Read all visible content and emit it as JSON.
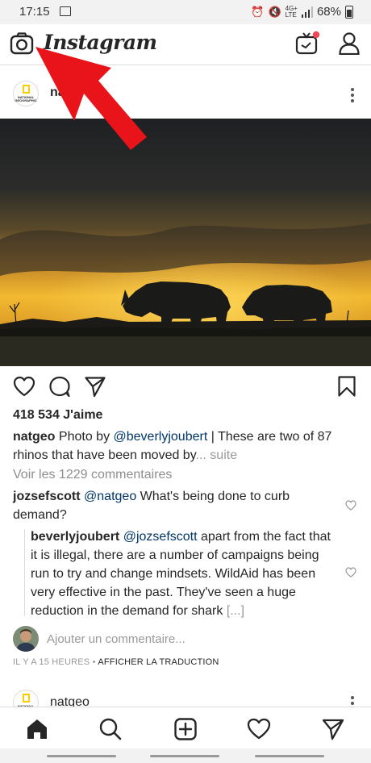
{
  "status_bar": {
    "time": "17:15",
    "battery": "68%",
    "network": "4G+",
    "network_sub": "LTE"
  },
  "app": {
    "title": "Instagram"
  },
  "post": {
    "username": "natgeo",
    "avatar_text": "NATIONAL GEOGRAPHIC",
    "likes": "418 534 J'aime",
    "caption_user": "natgeo",
    "caption_text_1": "Photo by ",
    "caption_mention": "@beverlyjoubert",
    "caption_text_2": " | These are two of 87 rhinos that have been moved by",
    "caption_more": "... suite",
    "view_comments": "Voir les 1229 commentaires",
    "comment1": {
      "user": "jozsefscott",
      "mention": "@natgeo",
      "text": " What's being done to curb demand?"
    },
    "reply": {
      "user": "beverlyjoubert",
      "mention": "@jozsefscott",
      "text": " apart from the fact that it is illegal, there are a number of campaigns being run to try and change mindsets. WildAid has been very effective in the past. They've seen a huge reduction in the demand for shark",
      "ellipsis": "[...]"
    },
    "add_comment_placeholder": "Ajouter un commentaire...",
    "time_ago": "IL Y A 15 HEURES",
    "separator": " • ",
    "translate": "AFFICHER LA TRADUCTION"
  },
  "next_post": {
    "username": "natgeo",
    "avatar_text": "NATIONAL"
  },
  "nav": {
    "items": [
      "home-icon",
      "search-icon",
      "add-post-icon",
      "activity-heart-icon",
      "direct-send-icon"
    ]
  },
  "colors": {
    "accent_red": "#e8141a",
    "link": "#003569",
    "notify_dot": "#ed4956"
  }
}
